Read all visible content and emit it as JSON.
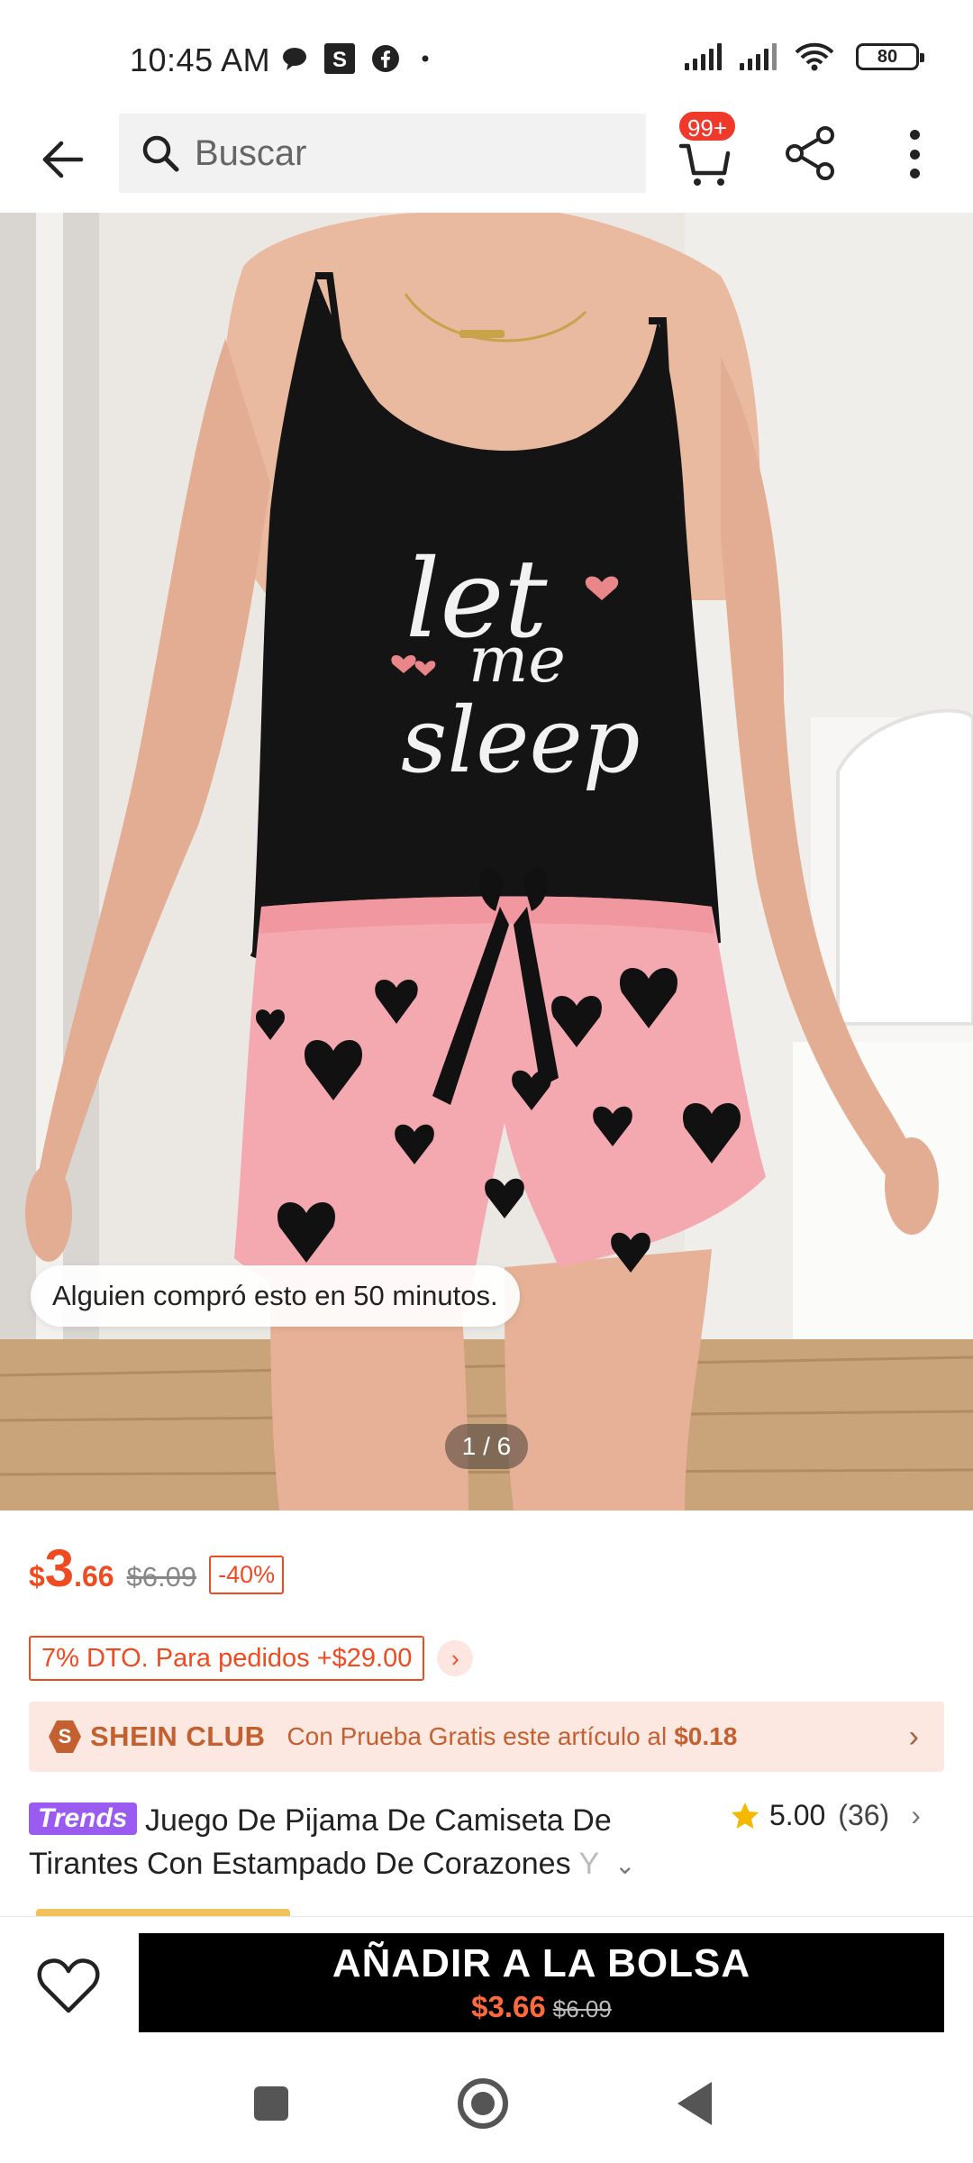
{
  "status_bar": {
    "time": "10:45 AM",
    "battery": "80",
    "icons_left": [
      "chat-bubble-icon",
      "s-app-icon",
      "facebook-icon",
      "dot-icon"
    ],
    "icons_right": [
      "signal-icon",
      "signal-icon",
      "wifi-icon",
      "battery-icon"
    ]
  },
  "header": {
    "search_placeholder": "Buscar",
    "cart_badge": "99+"
  },
  "gallery": {
    "printed_text": [
      "let",
      "me",
      "sleep"
    ],
    "toast": "Alguien compró esto en 50 minutos.",
    "counter": "1 / 6"
  },
  "price": {
    "currency": "$",
    "integer": "3",
    "decimal": ".66",
    "original": "$6.09",
    "discount": "-40%"
  },
  "coupon": {
    "text": "7% DTO. Para pedidos +$29.00",
    "arrow": "›"
  },
  "club": {
    "logo_letter": "S",
    "name": "SHEIN CLUB",
    "text": "Con Prueba Gratis este artículo al",
    "amount": "$0.18",
    "chevron": "›"
  },
  "product": {
    "badge": "rends",
    "badge_prefix": "T",
    "title_main": "Juego De Pijama De Camiseta De Tirantes Con Estampado De Corazones",
    "title_fade": "Y",
    "rating": "5.00",
    "rating_count": "(36)",
    "rating_chevron": "›",
    "expand_chevron": "⌄"
  },
  "action_bar": {
    "button_label": "AÑADIR A LA BOLSA",
    "price_new": "$3.66",
    "price_old": "$6.09"
  },
  "colors": {
    "accent": "#f04a21",
    "club": "#c4602f",
    "club_bg": "#fde8e1",
    "trends": "#9a5cf0",
    "shorts_pink": "#f4a9b1",
    "top_black": "#141414"
  }
}
